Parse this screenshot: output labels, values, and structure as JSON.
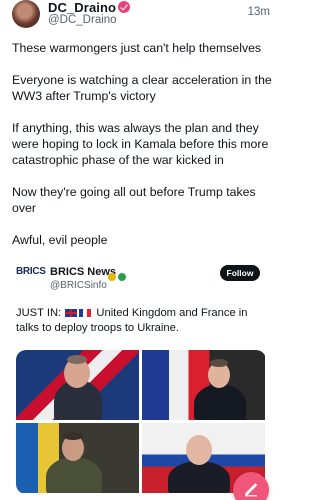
{
  "post": {
    "author_name": "DC_Draino",
    "author_handle": "@DC_Draino",
    "time": "13m",
    "paragraphs": [
      "These warmongers just can't help themselves",
      "Everyone is watching a clear acceleration in the WW3 after Trump's victory",
      "If anything, this was always the plan and they were hoping to lock in Kamala before this more catastrophic phase of the war kicked in",
      "Now they're going all out before Trump takes over",
      "Awful, evil people"
    ]
  },
  "quoted": {
    "logo_text": "BRICS",
    "name": "BRICS News",
    "handle": "@BRICSinfo",
    "follow_label": "Follow",
    "text_prefix": "JUST IN: ",
    "text_rest": " United Kingdom and France in talks to deploy troops to Ukraine."
  },
  "icons": {
    "verified": "verified-badge-icon",
    "compose": "compose-icon"
  },
  "colors": {
    "accent": "#f0557a",
    "verified": "#e8427a",
    "follow_bg": "#0f1419",
    "secondary_text": "#536471"
  }
}
